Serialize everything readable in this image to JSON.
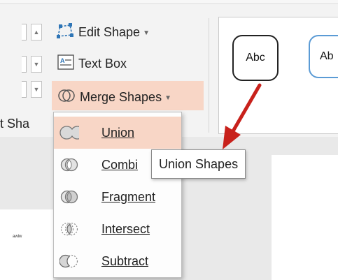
{
  "ribbon": {
    "edit_shape": {
      "label": "Edit Shape",
      "icon": "edit-shape-icon"
    },
    "text_box": {
      "label": "Text Box",
      "icon": "text-box-icon"
    },
    "merge_shapes": {
      "label": "Merge Shapes",
      "icon": "merge-shapes-icon"
    },
    "group_label": "t Sha",
    "shape_styles": [
      {
        "label": "Abc"
      },
      {
        "label": "Ab"
      }
    ]
  },
  "merge_menu": {
    "items": [
      {
        "label": "Union",
        "icon": "union-icon",
        "highlighted": true
      },
      {
        "label": "Combi",
        "icon": "combine-icon"
      },
      {
        "label": "Fragment",
        "icon": "fragment-icon"
      },
      {
        "label": "Intersect",
        "icon": "intersect-icon"
      },
      {
        "label": "Subtract",
        "icon": "subtract-icon"
      }
    ]
  },
  "tooltip": {
    "text": "Union Shapes"
  },
  "slide_thumbnail": {
    "text": "awlw"
  },
  "colors": {
    "accent": "#f8d6c6",
    "arrow": "#c8211b",
    "style_outline_blue": "#5b9bd5"
  }
}
